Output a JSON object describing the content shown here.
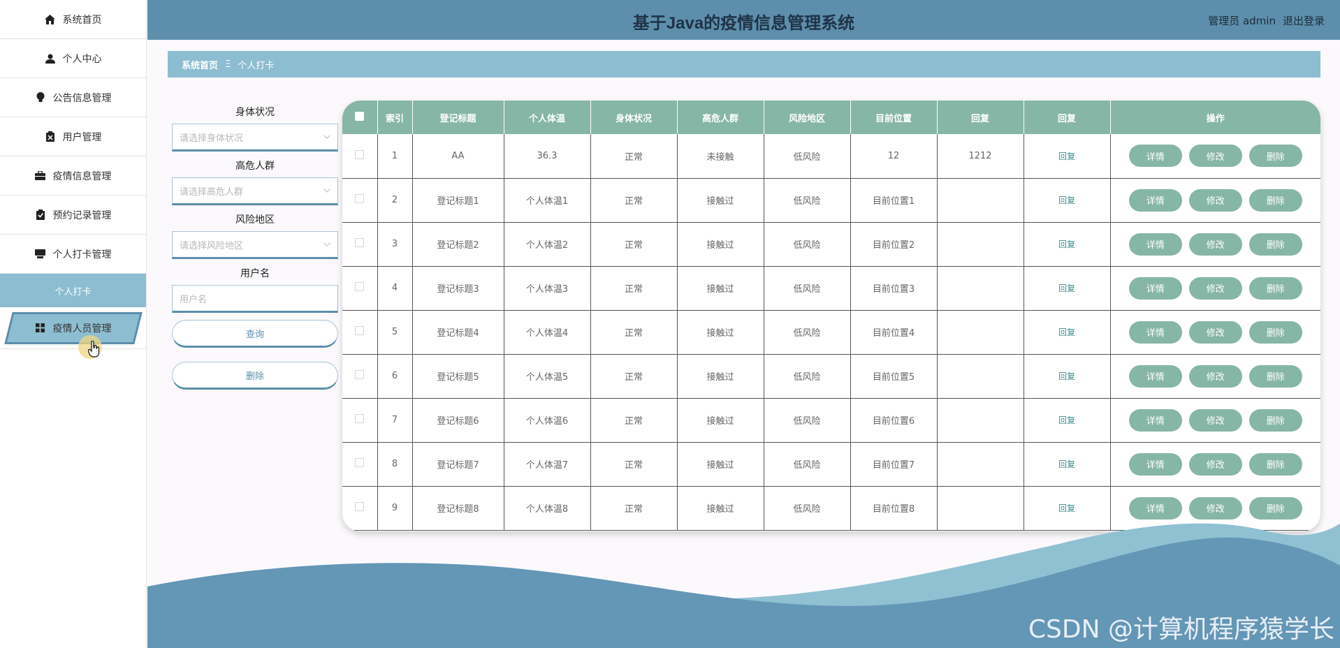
{
  "header": {
    "title": "基于Java的疫情信息管理系统",
    "user": "管理员 admin",
    "logout": "退出登录"
  },
  "sidebar": {
    "items": [
      {
        "label": "系统首页",
        "icon": "home-icon"
      },
      {
        "label": "个人中心",
        "icon": "user-icon"
      },
      {
        "label": "公告信息管理",
        "icon": "bulb-icon"
      },
      {
        "label": "用户管理",
        "icon": "clipboard-icon"
      },
      {
        "label": "疫情信息管理",
        "icon": "briefcase-icon"
      },
      {
        "label": "预约记录管理",
        "icon": "checklist-icon"
      },
      {
        "label": "个人打卡管理",
        "icon": "monitor-icon"
      }
    ],
    "sub_item": "个人打卡",
    "active_item": {
      "label": "疫情人员管理",
      "icon": "grid-icon"
    }
  },
  "breadcrumb": {
    "home": "系统首页",
    "separator": "Ξ",
    "current": "个人打卡"
  },
  "filter": {
    "health_label": "身体状况",
    "health_placeholder": "请选择身体状况",
    "risk_group_label": "高危人群",
    "risk_group_placeholder": "请选择高危人群",
    "risk_area_label": "风险地区",
    "risk_area_placeholder": "请选择风险地区",
    "username_label": "用户名",
    "username_placeholder": "用户名",
    "search_button": "查询",
    "delete_button": "删除"
  },
  "table": {
    "headers": [
      "索引",
      "登记标题",
      "个人体温",
      "身体状况",
      "高危人群",
      "风险地区",
      "目前位置",
      "回复",
      "回复",
      "操作"
    ],
    "reply_link": "回复",
    "actions": {
      "detail": "详情",
      "edit": "修改",
      "delete": "删除"
    },
    "rows": [
      {
        "index": "1",
        "title": "AA",
        "temp": "36.3",
        "health": "正常",
        "risk_group": "未接触",
        "risk_area": "低风险",
        "location": "12",
        "reply": "1212"
      },
      {
        "index": "2",
        "title": "登记标题1",
        "temp": "个人体温1",
        "health": "正常",
        "risk_group": "接触过",
        "risk_area": "低风险",
        "location": "目前位置1",
        "reply": ""
      },
      {
        "index": "3",
        "title": "登记标题2",
        "temp": "个人体温2",
        "health": "正常",
        "risk_group": "接触过",
        "risk_area": "低风险",
        "location": "目前位置2",
        "reply": ""
      },
      {
        "index": "4",
        "title": "登记标题3",
        "temp": "个人体温3",
        "health": "正常",
        "risk_group": "接触过",
        "risk_area": "低风险",
        "location": "目前位置3",
        "reply": ""
      },
      {
        "index": "5",
        "title": "登记标题4",
        "temp": "个人体温4",
        "health": "正常",
        "risk_group": "接触过",
        "risk_area": "低风险",
        "location": "目前位置4",
        "reply": ""
      },
      {
        "index": "6",
        "title": "登记标题5",
        "temp": "个人体温5",
        "health": "正常",
        "risk_group": "接触过",
        "risk_area": "低风险",
        "location": "目前位置5",
        "reply": ""
      },
      {
        "index": "7",
        "title": "登记标题6",
        "temp": "个人体温6",
        "health": "正常",
        "risk_group": "接触过",
        "risk_area": "低风险",
        "location": "目前位置6",
        "reply": ""
      },
      {
        "index": "8",
        "title": "登记标题7",
        "temp": "个人体温7",
        "health": "正常",
        "risk_group": "接触过",
        "risk_area": "低风险",
        "location": "目前位置7",
        "reply": ""
      },
      {
        "index": "9",
        "title": "登记标题8",
        "temp": "个人体温8",
        "health": "正常",
        "risk_group": "接触过",
        "risk_area": "低风险",
        "location": "目前位置8",
        "reply": ""
      }
    ]
  },
  "watermark": "CSDN @计算机程序猿学长",
  "colors": {
    "header_bg": "#5d8fad",
    "accent": "#8dbdd0",
    "table_header": "#86b6a6",
    "wave_dark": "#6496b6",
    "wave_light": "#8fc1d3"
  }
}
